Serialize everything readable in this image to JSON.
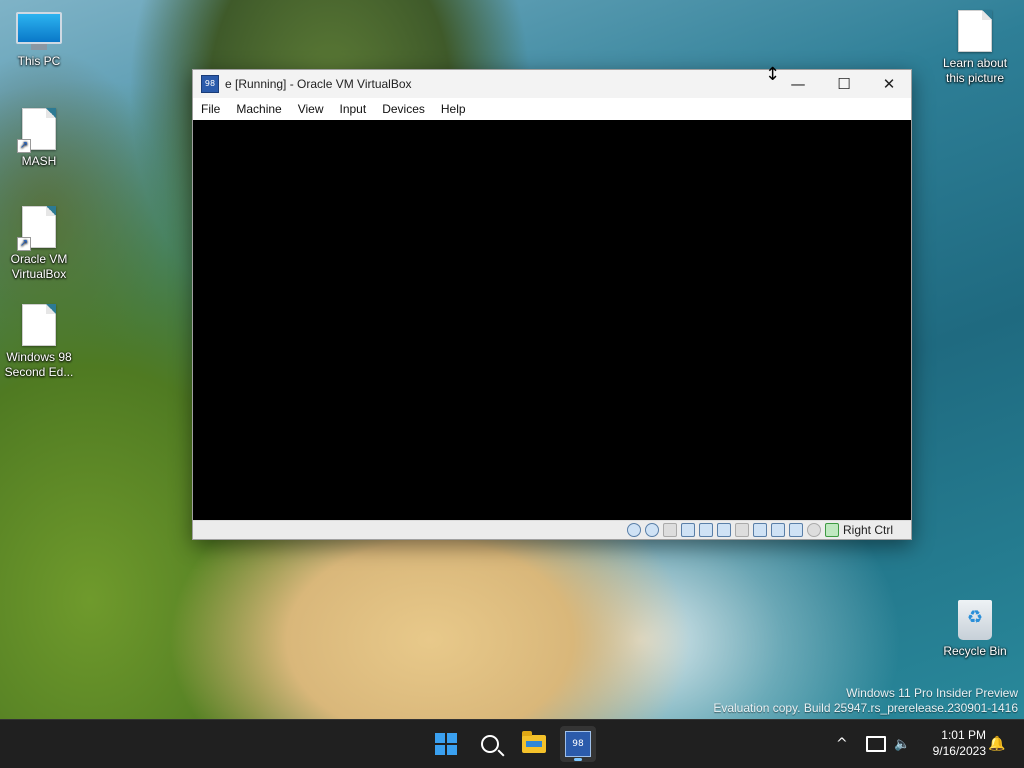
{
  "desktop": {
    "icons": [
      {
        "label": "This PC"
      },
      {
        "label": "MASH"
      },
      {
        "label_line1": "Oracle VM",
        "label_line2": "VirtualBox"
      },
      {
        "label_line1": "Windows 98",
        "label_line2": "Second Ed..."
      },
      {
        "label_line1": "Learn about",
        "label_line2": "this picture"
      },
      {
        "label": "Recycle Bin"
      }
    ],
    "watermark_line1": "Windows 11 Pro Insider Preview",
    "watermark_line2": "Evaluation copy. Build 25947.rs_prerelease.230901-1416"
  },
  "window": {
    "title": "e [Running] - Oracle VM VirtualBox",
    "app_icon_text": "98",
    "controls": {
      "minimize": "—",
      "maximize": "☐",
      "close": "✕"
    },
    "menu": [
      "File",
      "Machine",
      "View",
      "Input",
      "Devices",
      "Help"
    ],
    "status_icons": [
      "hard-disk",
      "optical-drive",
      "floppy",
      "audio",
      "network",
      "usb",
      "shared-folders",
      "display",
      "recording",
      "vrde",
      "cpu",
      "mouse-integration",
      "keyboard-capture"
    ],
    "host_key": "Right Ctrl"
  },
  "taskbar": {
    "apps": [
      "start",
      "search",
      "file-explorer",
      "virtualbox"
    ],
    "vbox_badge": "98",
    "tray_chevron": "^",
    "time": "1:01 PM",
    "date": "9/16/2023"
  },
  "colors": {
    "taskbar_bg": "#202020",
    "accent": "#7cc6ff",
    "vm_screen": "#000000"
  }
}
